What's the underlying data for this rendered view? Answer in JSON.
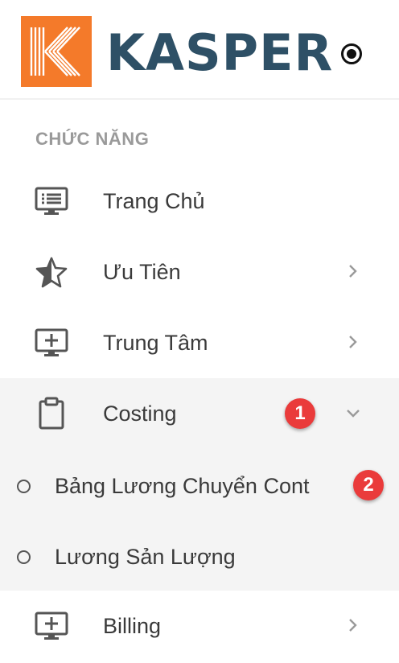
{
  "brand": {
    "name": "KASPER",
    "logo_color": "#f47a2a",
    "text_color": "#2e5066"
  },
  "section": {
    "title": "CHỨC NĂNG"
  },
  "menu": [
    {
      "label": "Trang Chủ",
      "icon": "monitor-list-icon"
    },
    {
      "label": "Ưu Tiên",
      "icon": "star-half-icon",
      "chevron": "right"
    },
    {
      "label": "Trung Tâm",
      "icon": "monitor-plus-icon",
      "chevron": "right"
    },
    {
      "label": "Costing",
      "icon": "clipboard-icon",
      "chevron": "down",
      "active": true
    },
    {
      "label": "Billing",
      "icon": "monitor-plus-icon",
      "chevron": "right"
    }
  ],
  "submenu": [
    {
      "label": "Bảng Lương Chuyển Cont"
    },
    {
      "label": "Lương Sản Lượng"
    }
  ],
  "badges": [
    "1",
    "2"
  ],
  "colors": {
    "badge": "#ea3b3b",
    "active_bg": "#f4f4f4",
    "section_title": "#9a9a9a"
  }
}
